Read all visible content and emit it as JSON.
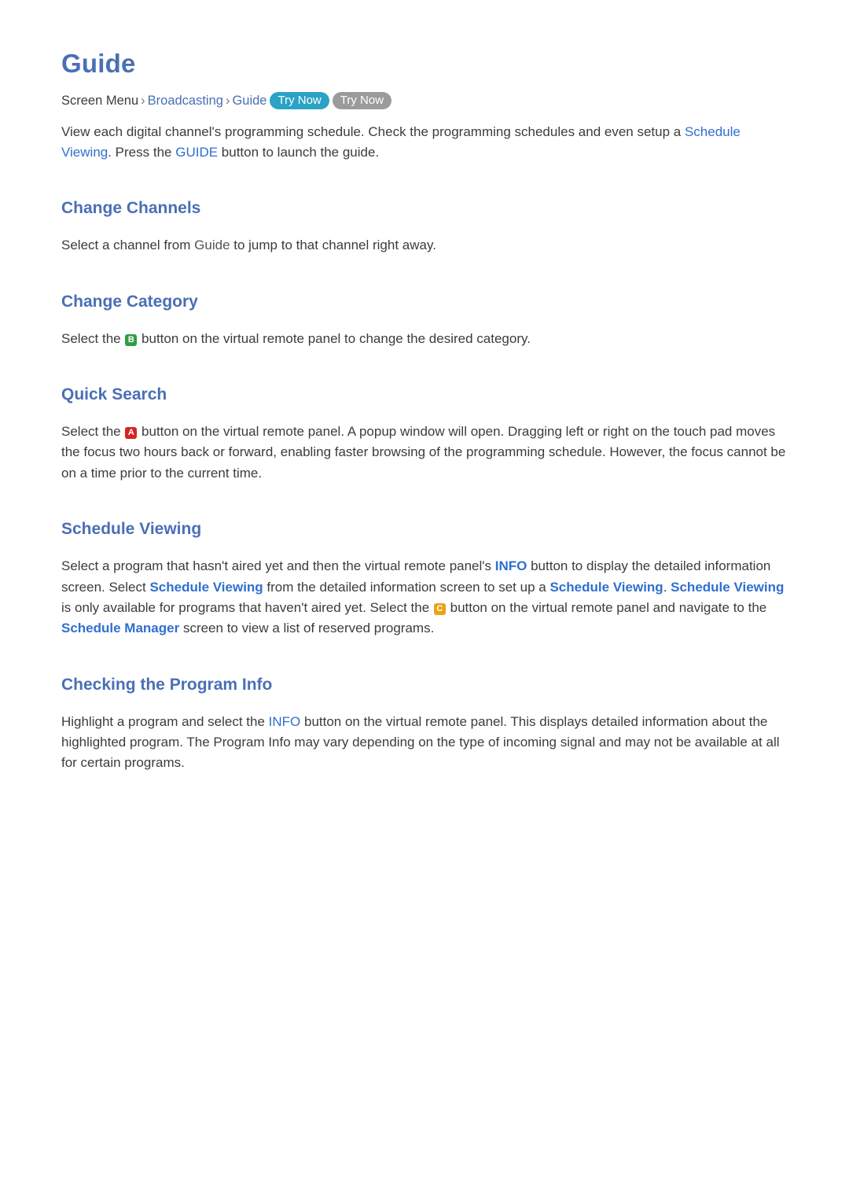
{
  "page": {
    "title": "Guide"
  },
  "breadcrumb": {
    "prefix": "Screen Menu",
    "sep": "›",
    "item1": "Broadcasting",
    "item2": "Guide",
    "try_now_1": "Try Now",
    "try_now_2": "Try Now"
  },
  "intro": {
    "t1": "View each digital channel's programming schedule. Check the programming schedules and even setup a ",
    "link1": "Schedule Viewing",
    "t2": ". Press the ",
    "key1": "GUIDE",
    "t3": " button to launch the guide."
  },
  "sections": [
    {
      "title": "Change Channels",
      "body": {
        "t1": "Select a channel from ",
        "link1": "Guide",
        "t2": " to jump to that channel right away."
      }
    },
    {
      "title": "Change Category",
      "body": {
        "t1": "Select the ",
        "key": "B",
        "t2": " button on the virtual remote panel to change the desired category."
      }
    },
    {
      "title": "Quick Search",
      "body": {
        "t1": "Select the ",
        "key": "A",
        "t2": " button on the virtual remote panel. A popup window will open. Dragging left or right on the touch pad moves the focus two hours back or forward, enabling faster browsing of the programming schedule. However, the focus cannot be on a time prior to the current time."
      }
    },
    {
      "title": "Schedule Viewing",
      "body": {
        "t1": "Select a program that hasn't aired yet and then the virtual remote panel's ",
        "k1": "INFO",
        "t2": " button to display the detailed information screen. Select ",
        "l1": "Schedule Viewing",
        "t3": " from the detailed information screen to set up a ",
        "l2": "Schedule Viewing",
        "t4": ". ",
        "l3": "Schedule Viewing",
        "t5": " is only available for programs that haven't aired yet. Select the ",
        "key": "C",
        "t6": " button on the virtual remote panel and navigate to the ",
        "l4": "Schedule Manager",
        "t7": " screen to view a list of reserved programs."
      }
    },
    {
      "title": "Checking the Program Info",
      "body": {
        "t1": "Highlight a program and select the ",
        "k1": "INFO",
        "t2": " button on the virtual remote panel. This displays detailed information about the highlighted program. The Program Info may vary depending on the type of incoming signal and may not be available at all for certain programs."
      }
    }
  ]
}
